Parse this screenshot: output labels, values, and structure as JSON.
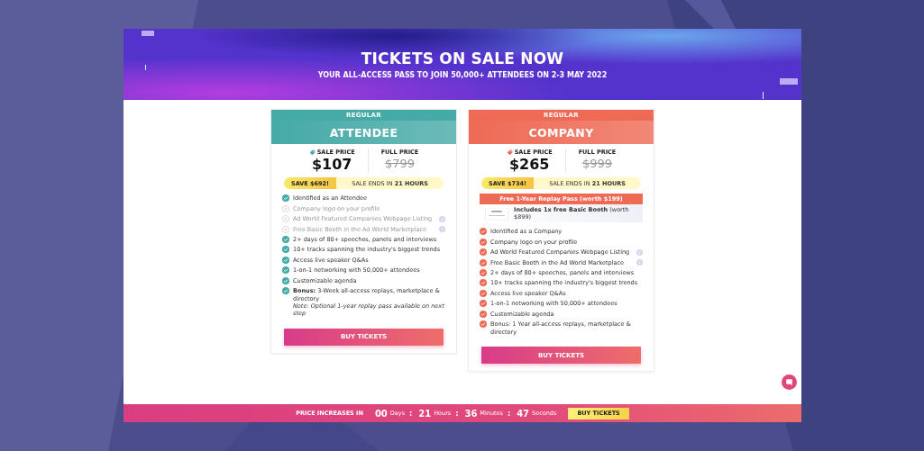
{
  "hero": {
    "title": "TICKETS ON SALE NOW",
    "subtitle": "YOUR ALL-ACCESS PASS TO JOIN 50,000+ ATTENDEES ON 2-3 MAY 2022"
  },
  "plans": [
    {
      "color": "#46aaa7",
      "tier": "REGULAR",
      "name": "ATTENDEE",
      "sale_label": "SALE PRICE",
      "sale_price": "$107",
      "full_label": "FULL PRICE",
      "full_price": "$799",
      "save": "SAVE $692!",
      "ends": "SALE ENDS IN **21 HOURS**",
      "features": [
        {
          "kind": "check",
          "text": "Identified as an Attendee",
          "info": false
        },
        {
          "kind": "cross",
          "text": "Company logo on your profile",
          "info": false
        },
        {
          "kind": "cross",
          "text": "Ad World Featured Companies Webpage Listing",
          "info": true
        },
        {
          "kind": "cross",
          "text": "Free Basic Booth in the Ad World Marketplace",
          "info": true
        },
        {
          "kind": "check",
          "text": "2+ days of 80+ speeches, panels and interviews",
          "info": false
        },
        {
          "kind": "check",
          "text": "10+ tracks spanning the industry's biggest trends",
          "info": false
        },
        {
          "kind": "check",
          "text": "Access live speaker Q&As",
          "info": false
        },
        {
          "kind": "check",
          "text": "1-on-1 networking with 50,000+ attendees",
          "info": false
        },
        {
          "kind": "check",
          "text": "Customizable agenda",
          "info": false
        },
        {
          "kind": "check",
          "text": "**Bonus:** 3-Week all-access replays, marketplace & directory",
          "note": "Note: Optional 1-year replay pass available on next step",
          "info": false
        }
      ],
      "button": "BUY TICKETS"
    },
    {
      "color": "#ee6a55",
      "tier": "REGULAR",
      "name": "COMPANY",
      "sale_label": "SALE PRICE",
      "sale_price": "$265",
      "full_label": "FULL PRICE",
      "full_price": "$999",
      "save": "SAVE $734!",
      "ends": "SALE ENDS IN **21 HOURS**",
      "banner": "Free 1-Year Replay Pass (worth $199)",
      "included": "**Includes 1x free Basic Booth** (worth $899)",
      "features": [
        {
          "kind": "check",
          "text": "Identified as a Company",
          "info": false
        },
        {
          "kind": "check",
          "text": "Company logo on your profile",
          "info": false
        },
        {
          "kind": "check",
          "text": "Ad World Featured Companies Webpage Listing",
          "info": true
        },
        {
          "kind": "check",
          "text": "Free Basic Booth in the Ad World Marketplace",
          "info": true
        },
        {
          "kind": "check",
          "text": "2+ days of 80+ speeches, panels and interviews",
          "info": false
        },
        {
          "kind": "check",
          "text": "10+ tracks spanning the industry's biggest trends",
          "info": false
        },
        {
          "kind": "check",
          "text": "Access live speaker Q&As",
          "info": false
        },
        {
          "kind": "check",
          "text": "1-on-1 networking with 50,000+ attendees",
          "info": false
        },
        {
          "kind": "check",
          "text": "Customizable agenda",
          "info": false
        },
        {
          "kind": "check",
          "text": "Bonus: 1 Year all-access replays, marketplace & directory",
          "info": false
        }
      ],
      "button": "BUY TICKETS"
    }
  ],
  "countdown": {
    "label": "PRICE INCREASES IN",
    "units": [
      {
        "value": "00",
        "unit": "Days"
      },
      {
        "value": "21",
        "unit": "Hours"
      },
      {
        "value": "36",
        "unit": "Minutes"
      },
      {
        "value": "47",
        "unit": "Seconds"
      }
    ],
    "separator": ":",
    "button": "BUY TICKETS"
  }
}
